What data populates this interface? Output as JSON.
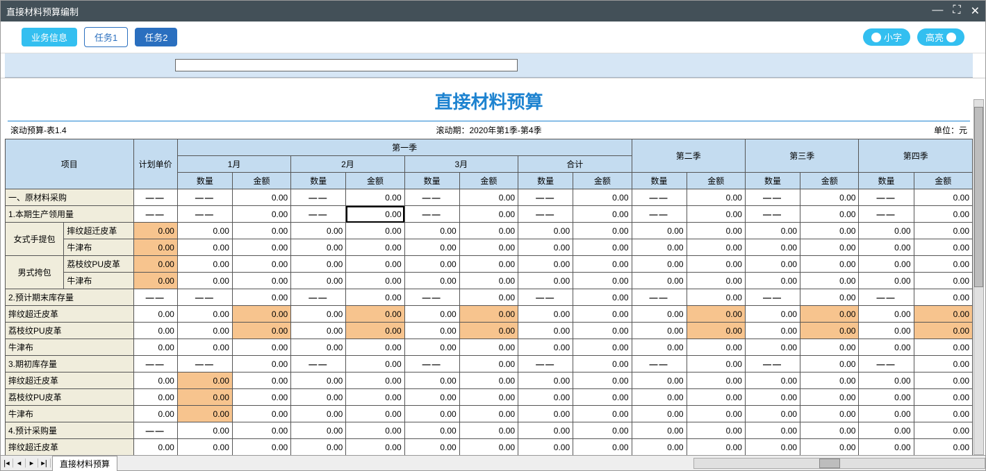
{
  "window": {
    "title": "直接材料预算编制"
  },
  "toolbar": {
    "biz": "业务信息",
    "task1": "任务1",
    "task2": "任务2",
    "small": "小字",
    "highlight": "高亮"
  },
  "report": {
    "title": "直接材料预算",
    "meta_left": "滚动预算-表1.4",
    "meta_center": "滚动期：2020年第1季-第4季",
    "meta_right": "单位：元"
  },
  "headers": {
    "item": "项目",
    "unitprice": "计划单价",
    "q1": "第一季",
    "q2": "第二季",
    "q3": "第三季",
    "q4": "第四季",
    "m1": "1月",
    "m2": "2月",
    "m3": "3月",
    "subtotal": "合计",
    "qty": "数量",
    "amt": "金额"
  },
  "rows": [
    {
      "kind": "section",
      "label": "一、原材料采购",
      "dash_cols": [
        0,
        1,
        3,
        5,
        7,
        9,
        11,
        13
      ]
    },
    {
      "kind": "section",
      "label": "1.本期生产领用量",
      "dash_cols": [
        0,
        1,
        3,
        5,
        7,
        9,
        11,
        13
      ],
      "selected": 4
    },
    {
      "kind": "sub",
      "group": "女式手提包",
      "label": "摔纹超迁皮革",
      "orange": [
        0
      ]
    },
    {
      "kind": "sub",
      "group": "女式手提包",
      "label": "牛津布",
      "orange": [
        0
      ]
    },
    {
      "kind": "sub",
      "group": "男式挎包",
      "label": "荔枝纹PU皮革",
      "orange": [
        0
      ]
    },
    {
      "kind": "sub",
      "group": "男式挎包",
      "label": "牛津布",
      "orange": [
        0
      ]
    },
    {
      "kind": "section",
      "label": "2.预计期末库存量",
      "dash_cols": [
        0,
        1,
        3,
        5,
        7,
        9,
        11,
        13
      ]
    },
    {
      "kind": "full",
      "label": "摔纹超迁皮革",
      "orange": [
        2,
        4,
        6,
        10,
        12,
        14
      ]
    },
    {
      "kind": "full",
      "label": "荔枝纹PU皮革",
      "orange": [
        2,
        4,
        6,
        10,
        12,
        14
      ]
    },
    {
      "kind": "full",
      "label": "牛津布"
    },
    {
      "kind": "section",
      "label": "3.期初库存量",
      "dash_cols": [
        0,
        1,
        3,
        5,
        7,
        9,
        11,
        13
      ]
    },
    {
      "kind": "full",
      "label": "摔纹超迁皮革",
      "orange": [
        1
      ]
    },
    {
      "kind": "full",
      "label": "荔枝纹PU皮革",
      "orange": [
        1
      ]
    },
    {
      "kind": "full",
      "label": "牛津布",
      "orange": [
        1
      ]
    },
    {
      "kind": "section",
      "label": "4.预计采购量",
      "dash_cols": [
        0
      ]
    },
    {
      "kind": "full",
      "label": "摔纹超迁皮革"
    }
  ],
  "dash": "——",
  "zero": "0.00",
  "footer": {
    "tab": "直接材料预算"
  }
}
